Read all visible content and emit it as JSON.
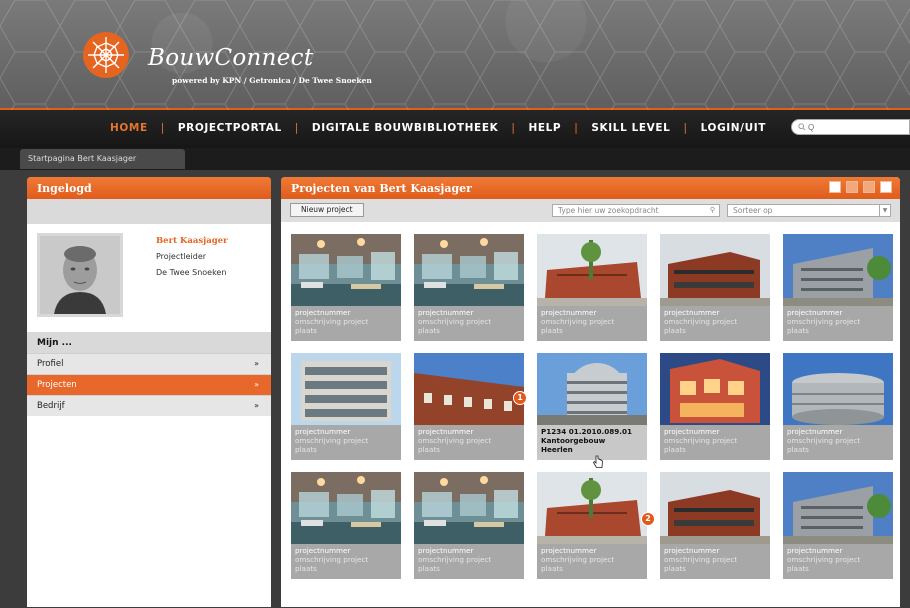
{
  "brand": {
    "name": "BouwConnect",
    "tagline": "powered by KPN / Getronica / De Twee Snoeken"
  },
  "nav": {
    "items": [
      "HOME",
      "PROJECTPORTAL",
      "DIGITALE BOUWBIBLIOTHEEK",
      "HELP",
      "SKILL LEVEL",
      "LOGIN/UIT"
    ],
    "active_index": 0,
    "search_placeholder": "Q"
  },
  "breadcrumb": "Startpagina Bert Kaasjager",
  "left": {
    "title": "Ingelogd",
    "user": {
      "name": "Bert Kaasjager",
      "role": "Projectleider",
      "company": "De Twee Snoeken"
    },
    "section_title": "Mijn ...",
    "menu": [
      {
        "label": "Profiel",
        "arrow": "»",
        "active": false
      },
      {
        "label": "Projecten",
        "arrow": "»",
        "active": true
      },
      {
        "label": "Bedrijf",
        "arrow": "»",
        "active": false
      }
    ]
  },
  "right": {
    "title": "Projecten van Bert Kaasjager",
    "new_project_label": "Nieuw project",
    "search_placeholder": "Type hier uw zoekopdracht",
    "sort_placeholder": "Sorteer op",
    "tiles": [
      {
        "line1": "projectnummer",
        "line2": "omschrijving project",
        "line3": "plaats",
        "image": "interior-office"
      },
      {
        "line1": "projectnummer",
        "line2": "omschrijving project",
        "line3": "plaats",
        "image": "interior-office"
      },
      {
        "line1": "projectnummer",
        "line2": "omschrijving project",
        "line3": "plaats",
        "image": "brick-building"
      },
      {
        "line1": "projectnummer",
        "line2": "omschrijving project",
        "line3": "plaats",
        "image": "brick-building-dark"
      },
      {
        "line1": "projectnummer",
        "line2": "omschrijving project",
        "line3": "plaats",
        "image": "grey-building"
      },
      {
        "line1": "projectnummer",
        "line2": "omschrijving project",
        "line3": "plaats",
        "image": "apartments"
      },
      {
        "line1": "projectnummer",
        "line2": "omschrijving project",
        "line3": "plaats",
        "image": "brick-row"
      },
      {
        "line1": "P1234 01.2010.089.01",
        "line2": "Kantoorgebouw",
        "line3": "Heerlen",
        "image": "round-tower",
        "highlight": true
      },
      {
        "line1": "projectnummer",
        "line2": "omschrijving project",
        "line3": "plaats",
        "image": "night-facade"
      },
      {
        "line1": "projectnummer",
        "line2": "omschrijving project",
        "line3": "plaats",
        "image": "round-silver"
      },
      {
        "line1": "projectnummer",
        "line2": "omschrijving project",
        "line3": "plaats",
        "image": "interior-office"
      },
      {
        "line1": "projectnummer",
        "line2": "omschrijving project",
        "line3": "plaats",
        "image": "interior-office"
      },
      {
        "line1": "projectnummer",
        "line2": "omschrijving project",
        "line3": "plaats",
        "image": "brick-building"
      },
      {
        "line1": "projectnummer",
        "line2": "omschrijving project",
        "line3": "plaats",
        "image": "brick-building-dark"
      },
      {
        "line1": "projectnummer",
        "line2": "omschrijving project",
        "line3": "plaats",
        "image": "grey-building"
      }
    ],
    "markers": [
      "1",
      "2"
    ]
  },
  "colors": {
    "accent": "#e5641f",
    "header_bg": "#6e6e6e",
    "nav_bg": "#1f1f1f"
  }
}
